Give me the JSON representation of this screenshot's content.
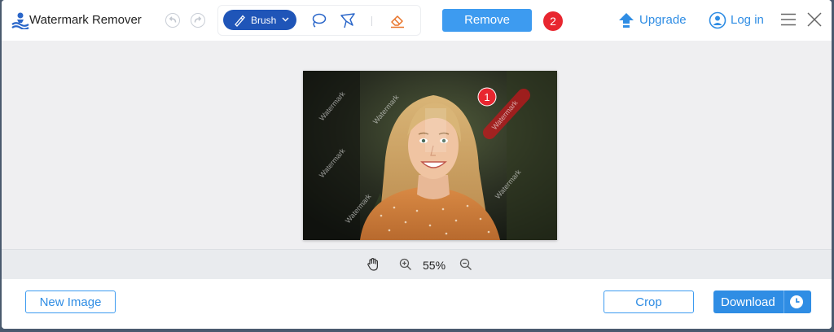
{
  "app": {
    "title": "Watermark Remover"
  },
  "toolbar": {
    "brush_label": "Brush",
    "remove_label": "Remove",
    "remove_badge": "2",
    "upgrade_label": "Upgrade",
    "login_label": "Log in"
  },
  "image": {
    "watermark_text": "Watermark",
    "area_badge": "1"
  },
  "zoom": {
    "level": "55%"
  },
  "footer": {
    "new_image_label": "New Image",
    "crop_label": "Crop",
    "download_label": "Download"
  },
  "colors": {
    "accent": "#3d9bf0",
    "brush_active": "#1f55b8",
    "badge": "#e8262f",
    "eraser": "#e8742a"
  }
}
